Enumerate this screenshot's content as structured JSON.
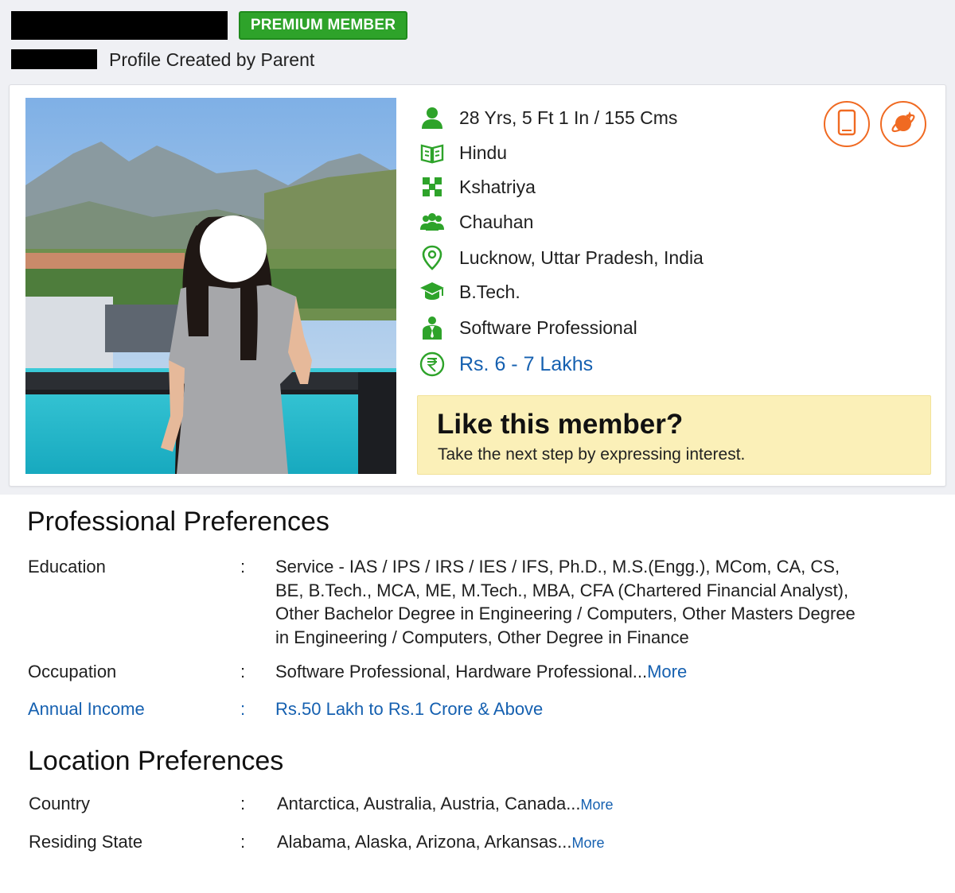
{
  "header": {
    "badge": "PREMIUM MEMBER",
    "created_by": "Profile Created by Parent"
  },
  "profile": {
    "facts": [
      {
        "icon": "person-icon",
        "text": "28 Yrs, 5 Ft 1 In / 155 Cms"
      },
      {
        "icon": "religion-book-icon",
        "text": "Hindu"
      },
      {
        "icon": "community-icon",
        "text": "Kshatriya"
      },
      {
        "icon": "group-icon",
        "text": "Chauhan"
      },
      {
        "icon": "location-pin-icon",
        "text": "Lucknow, Uttar Pradesh, India"
      },
      {
        "icon": "graduation-cap-icon",
        "text": "B.Tech."
      },
      {
        "icon": "professional-icon",
        "text": "Software Professional"
      },
      {
        "icon": "rupee-icon",
        "text": "Rs. 6 - 7 Lakhs"
      }
    ],
    "actions": [
      "phone-icon",
      "horoscope-icon"
    ],
    "like": {
      "title": "Like this member?",
      "subtitle": "Take the next step by expressing interest."
    }
  },
  "professional": {
    "title": "Professional Preferences",
    "rows": [
      {
        "label": "Education",
        "lines": [
          "Service - IAS / IPS / IRS / IES / IFS, Ph.D.,  M.S.(Engg.), MCom, CA, CS,",
          "BE, B.Tech., MCA, ME, M.Tech., MBA, CFA (Chartered Financial Analyst),",
          "Other Bachelor Degree in Engineering / Computers, Other Masters Degree",
          "in Engineering / Computers, Other Degree in Finance"
        ]
      },
      {
        "label": "Occupation",
        "value": "Software Professional, Hardware Professional...",
        "more": "More"
      },
      {
        "label": "Annual Income",
        "value": "Rs.50 Lakh to Rs.1 Crore & Above"
      }
    ]
  },
  "location": {
    "title": "Location Preferences",
    "rows": [
      {
        "label": "Country",
        "value": "Antarctica, Australia, Austria, Canada...",
        "more": "More"
      },
      {
        "label": "Residing State",
        "value": "Alabama, Alaska, Arizona, Arkansas...",
        "more": "More"
      }
    ]
  },
  "colon": ":",
  "colors": {
    "green": "#2ea32a",
    "orange": "#f06a22",
    "link_blue": "#1560b0",
    "like_bg": "#fbf0b8"
  }
}
